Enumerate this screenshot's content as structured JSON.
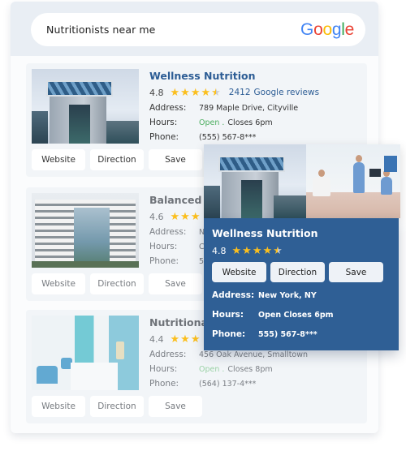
{
  "search": {
    "query": "Nutritionists near me",
    "engine_logo": [
      "G",
      "o",
      "o",
      "g",
      "l",
      "e"
    ]
  },
  "labels": {
    "address": "Address:",
    "hours": "Hours:",
    "phone": "Phone:",
    "open": "Open .",
    "website": "Website",
    "direction": "Direction",
    "save": "Save"
  },
  "listings": [
    {
      "name": "Wellness Nutrition",
      "rating": "4.8",
      "stars": 4.5,
      "review_count": "2412",
      "review_label": "Google reviews",
      "address": "789 Maple Drive, Cityville",
      "hours": "Closes 6pm",
      "phone": "(555) 567-8***",
      "image": "office-building-gate"
    },
    {
      "name": "Balanced L",
      "rating": "4.6",
      "stars": 3,
      "address": "N",
      "hours": "C",
      "phone": "5",
      "image": "glass-office-tower"
    },
    {
      "name": "Nutritional",
      "rating": "4.4",
      "stars": 3,
      "address": "456 Oak Avenue, Smalltown",
      "hours": "Closes 8pm",
      "phone": "(564) 137-4***",
      "image": "clinic-reception"
    }
  ],
  "popup": {
    "name": "Wellness Nutrition",
    "rating": "4.8",
    "stars": 4.5,
    "address": "New York, NY",
    "hours": "Open Closes 6pm",
    "phone": "555) 567-8***",
    "images": [
      "office-building-gate",
      "clinic-staff"
    ]
  },
  "colors": {
    "brand_blue": "#2f5f95",
    "link_blue": "#2d5d95",
    "star_gold": "#fbbf1e",
    "open_green": "#4cae5f"
  }
}
